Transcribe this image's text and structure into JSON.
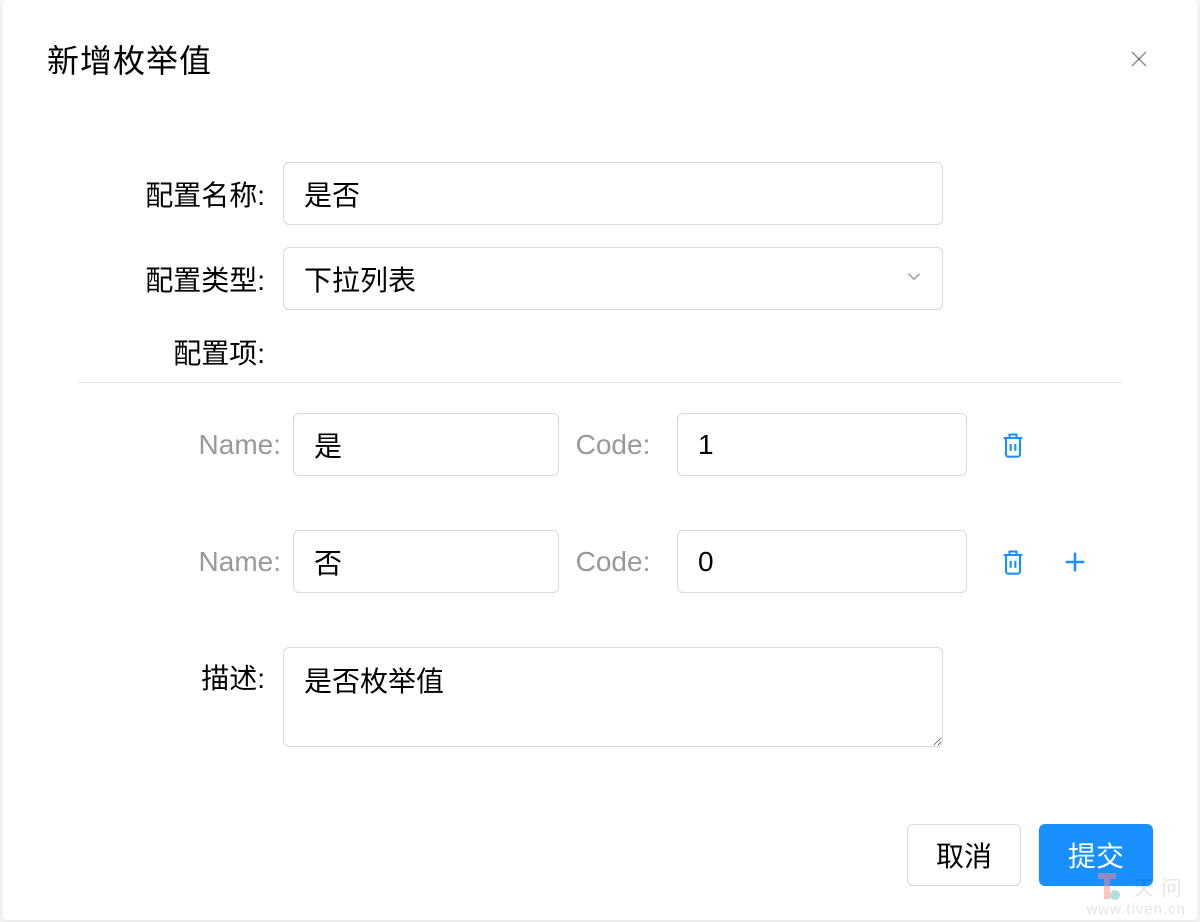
{
  "modal": {
    "title": "新增枚举值",
    "labels": {
      "config_name": "配置名称:",
      "config_type": "配置类型:",
      "config_items": "配置项:",
      "name_sub": "Name:",
      "code_sub": "Code:",
      "description": "描述:"
    },
    "values": {
      "config_name": "是否",
      "config_type": "下拉列表",
      "description": "是否枚举值"
    },
    "items": [
      {
        "name": "是",
        "code": "1"
      },
      {
        "name": "否",
        "code": "0"
      }
    ],
    "buttons": {
      "cancel": "取消",
      "submit": "提交"
    }
  },
  "watermark": {
    "line1": "天 问",
    "line2": "www.tiven.cn"
  }
}
